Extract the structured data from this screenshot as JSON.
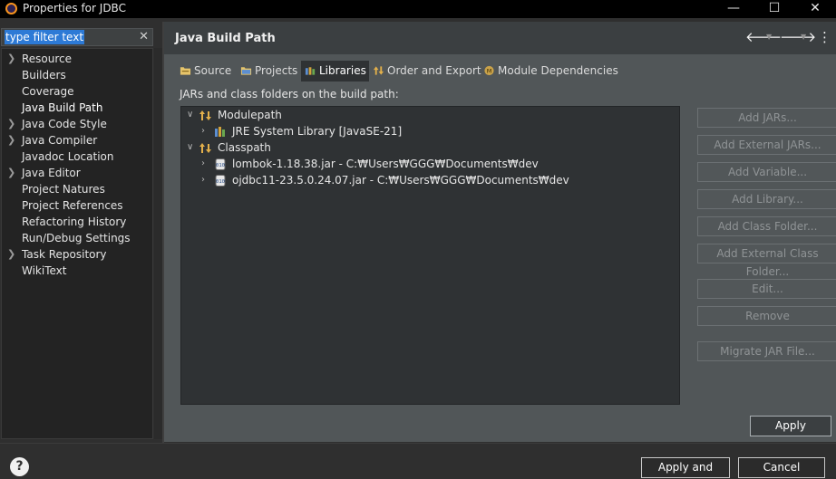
{
  "window": {
    "title": "Properties for JDBC",
    "min_glyph": "—",
    "max_glyph": "☐",
    "close_glyph": "✕"
  },
  "filter": {
    "text": "type filter text",
    "clear_glyph": "✕"
  },
  "nav": {
    "items": [
      {
        "label": "Resource",
        "expandable": true
      },
      {
        "label": "Builders",
        "expandable": false
      },
      {
        "label": "Coverage",
        "expandable": false
      },
      {
        "label": "Java Build Path",
        "expandable": false,
        "selected": true
      },
      {
        "label": "Java Code Style",
        "expandable": true
      },
      {
        "label": "Java Compiler",
        "expandable": true
      },
      {
        "label": "Javadoc Location",
        "expandable": false
      },
      {
        "label": "Java Editor",
        "expandable": true
      },
      {
        "label": "Project Natures",
        "expandable": false
      },
      {
        "label": "Project References",
        "expandable": false
      },
      {
        "label": "Refactoring History",
        "expandable": false
      },
      {
        "label": "Run/Debug Settings",
        "expandable": false
      },
      {
        "label": "Task Repository",
        "expandable": true
      },
      {
        "label": "WikiText",
        "expandable": false
      }
    ]
  },
  "header": {
    "title": "Java Build Path",
    "back_glyph": "🡐",
    "forward_glyph": "🡒",
    "menu_glyph": "⋮"
  },
  "tabs": [
    {
      "label": "Source",
      "icon": "source-folder-icon"
    },
    {
      "label": "Projects",
      "icon": "projects-icon"
    },
    {
      "label": "Libraries",
      "icon": "libraries-icon",
      "active": true
    },
    {
      "label": "Order and Export",
      "icon": "order-export-icon"
    },
    {
      "label": "Module Dependencies",
      "icon": "module-dependencies-icon"
    }
  ],
  "libraries": {
    "label": "JARs and class folders on the build path:",
    "modulepath": {
      "label": "Modulepath",
      "children": [
        "JRE System Library [JavaSE-21]"
      ]
    },
    "classpath": {
      "label": "Classpath",
      "children": [
        "lombok-1.18.38.jar - C:₩Users₩GGG₩Documents₩dev",
        "ojdbc11-23.5.0.24.07.jar - C:₩Users₩GGG₩Documents₩dev"
      ]
    }
  },
  "side_buttons": {
    "add_jars": "Add JARs...",
    "add_external_jars": "Add External JARs...",
    "add_variable": "Add Variable...",
    "add_library": "Add Library...",
    "add_class_folder": "Add Class Folder...",
    "add_external_class_folder": "Add External Class Folder...",
    "edit": "Edit...",
    "remove": "Remove",
    "migrate_jar": "Migrate JAR File..."
  },
  "apply": "Apply",
  "footer": {
    "help_glyph": "?",
    "apply_and_close": "Apply and Close",
    "cancel": "Cancel"
  },
  "colors": {
    "accent_selection": "#2d7ad6",
    "panel_bg": "#515658",
    "tree_bg": "#2f3234"
  }
}
